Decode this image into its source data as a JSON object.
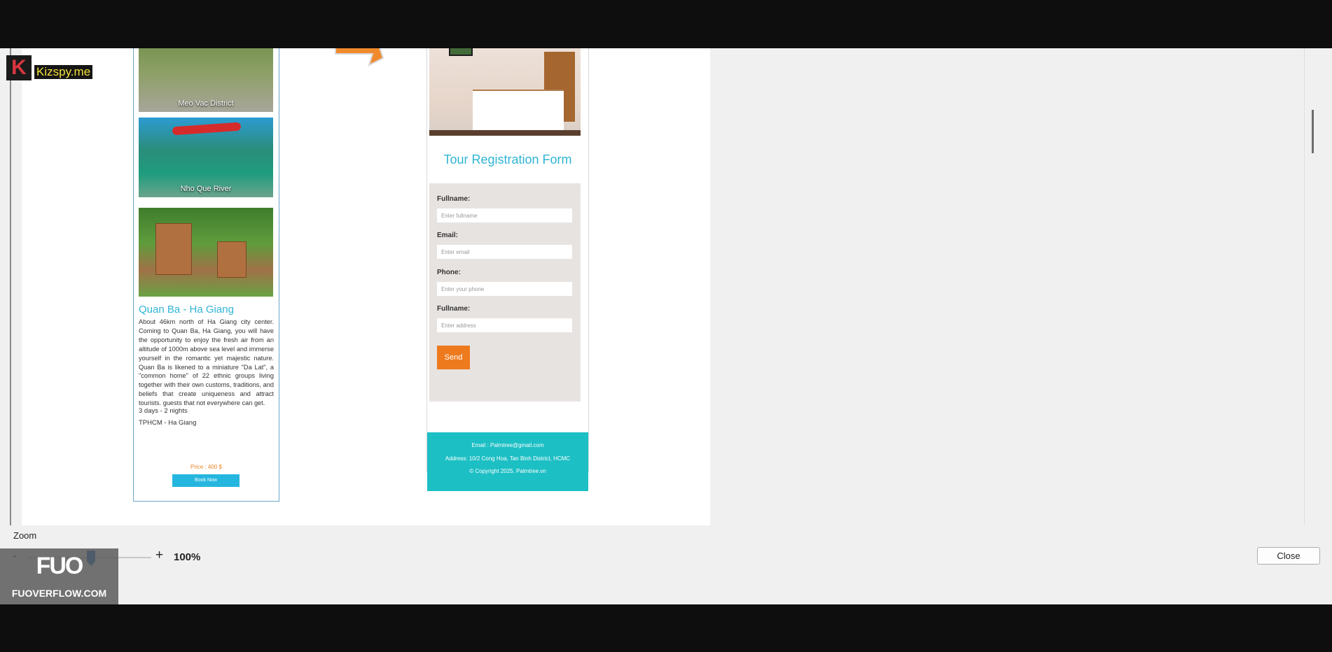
{
  "watermark_top": {
    "letter": "K",
    "text": "Kizspy.me"
  },
  "tour_card": {
    "image1_caption": "Meo Vac District",
    "image2_caption": "Nho Que River",
    "title": "Quan Ba - Ha Giang",
    "description": "About 46km north of Ha Giang city center. Coming to Quan Ba, Ha Giang, you will have the opportunity to enjoy the fresh air from an altitude of 1000m above sea level and immerse yourself in the romantic yet majestic nature. Quan Ba is likened to a miniature \"Da Lat\", a \"common home\" of 22 ethnic groups living together with their own customs, traditions, and beliefs that create uniqueness and attract tourists. guests that not everywhere can get.",
    "duration": "3 days - 2 nights",
    "route": "TPHCM - Ha Giang",
    "price": "Price : 400 $",
    "book_label": "Book Now"
  },
  "registration": {
    "title": "Tour Registration Form",
    "fields": [
      {
        "label": "Fullname:",
        "placeholder": "Enter fullname"
      },
      {
        "label": "Email:",
        "placeholder": "Enter email"
      },
      {
        "label": "Phone:",
        "placeholder": "Enter your phone"
      },
      {
        "label": "Fullname:",
        "placeholder": "Enter address"
      }
    ],
    "send_label": "Send",
    "footer": {
      "email": "Email : Palmtree@gmail.com",
      "address": "Address: 10/2 Cong Hoa, Tan Binh District, HCMC",
      "copyright": "© Copyright 2025. Palmtree.vn"
    }
  },
  "zoom": {
    "label": "Zoom",
    "minus": "-",
    "plus": "+",
    "value": "100%",
    "level_percent": 100
  },
  "close_label": "Close",
  "watermark_bottom": {
    "logo": "FUO",
    "text": "FUOVERFLOW.COM"
  },
  "colors": {
    "accent_blue": "#2fb4d5",
    "send_orange": "#ee7a1e",
    "footer_teal": "#1cbfc4"
  }
}
